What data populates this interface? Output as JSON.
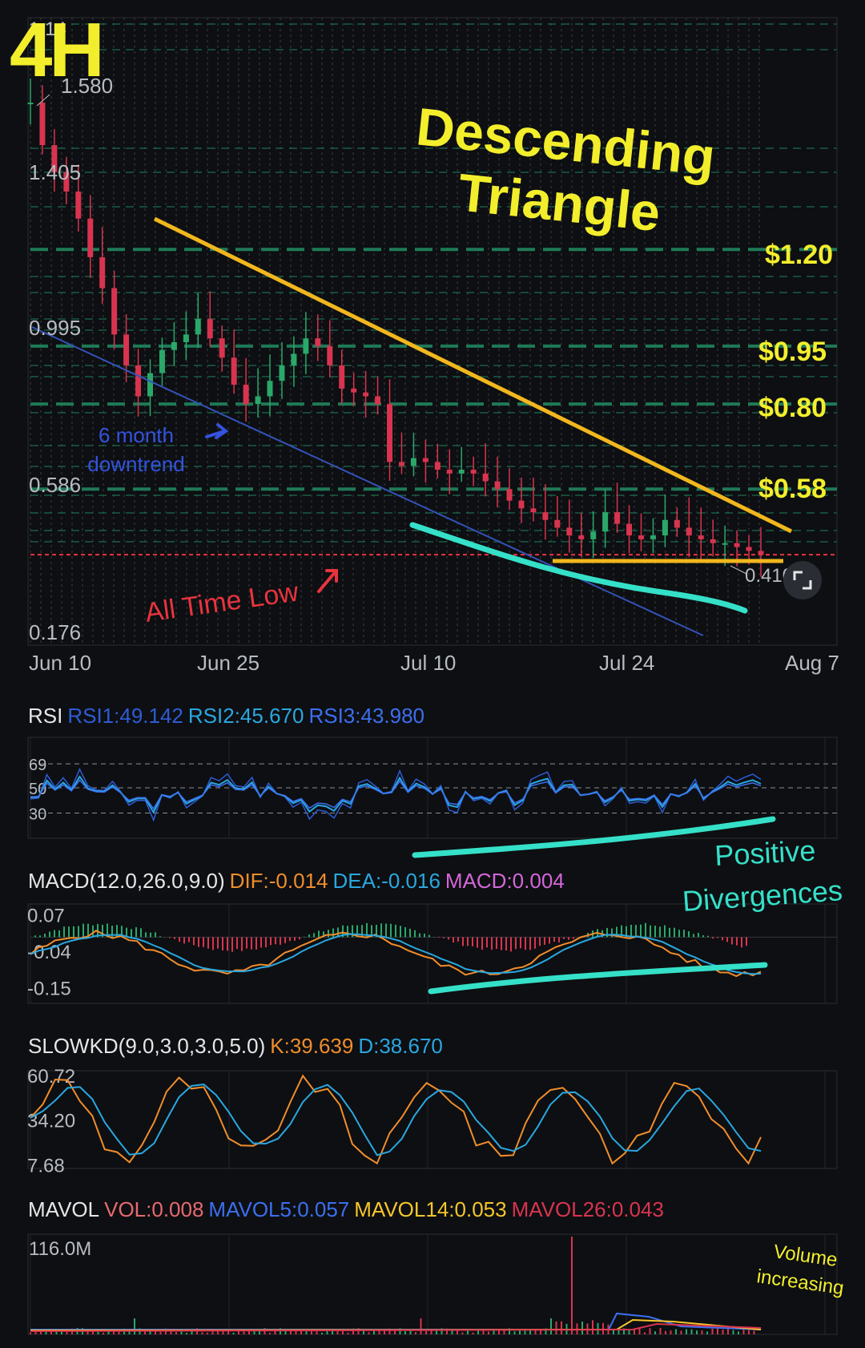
{
  "timeframe": "4H",
  "x_labels": [
    "Jun 10",
    "Jun 25",
    "Jul 10",
    "Jul 24",
    "Aug 7"
  ],
  "price": {
    "axis_labels": [
      "1.580",
      "1.405",
      "0.995",
      "0.586",
      "0.176"
    ],
    "top_partial_label": "1.14",
    "last_price_label": "0.410",
    "level_labels": [
      "$1.20",
      "$0.95",
      "$0.80",
      "$0.58"
    ],
    "ylim": [
      0.176,
      1.8
    ]
  },
  "annotations": {
    "title_line1": "Descending",
    "title_line2": "Triangle",
    "downtrend_line1": "6 month",
    "downtrend_line2": "downtrend",
    "atl": "All Time Low",
    "divergence_line1": "Positive",
    "divergence_line2": "Divergences",
    "volume_line1": "Volume",
    "volume_line2": "increasing"
  },
  "rsi": {
    "label": "RSI",
    "rsi1": "RSI1:49.142",
    "rsi2": "RSI2:45.670",
    "rsi3": "RSI3:43.980",
    "levels": [
      "69",
      "50",
      "30"
    ]
  },
  "macd": {
    "label": "MACD(12.0,26.0,9.0)",
    "dif": "DIF:-0.014",
    "dea": "DEA:-0.016",
    "macd": "MACD:0.004",
    "levels": [
      "0.07",
      "-0.04",
      "-0.15"
    ]
  },
  "slowkd": {
    "label": "SLOWKD(9.0,3.0,3.0,5.0)",
    "k": "K:39.639",
    "d": "D:38.670",
    "levels": [
      "60.72",
      "34.20",
      "7.68"
    ]
  },
  "mavol": {
    "label": "MAVOL",
    "vol": "VOL:0.008",
    "ma5": "MAVOL5:0.057",
    "ma14": "MAVOL14:0.053",
    "ma26": "MAVOL26:0.043",
    "max_label": "116.0M"
  },
  "colors": {
    "up": "#2aa86a",
    "down": "#d8344f",
    "trend": "#f2b71e",
    "teal": "#35e0c8",
    "yellow": "#f3ee2c",
    "red": "#e8343e",
    "blue": "#2f5bd6",
    "grid": "#1f7a57",
    "orange": "#f08d2c",
    "cyan": "#2aa7e0",
    "pink": "#d566d8",
    "mavol_blue": "#3c6ff0",
    "mavol_yellow": "#f6c52b",
    "mavol_red": "#d8344f"
  },
  "chart_data": [
    {
      "type": "candlestick",
      "title": "4H",
      "x": [
        "Jun 10",
        "Jun 25",
        "Jul 10",
        "Jul 24",
        "Aug 7"
      ],
      "close_points": [
        [
          0,
          1.58
        ],
        [
          1,
          1.47
        ],
        [
          2,
          1.4
        ],
        [
          3,
          1.35
        ],
        [
          4,
          1.28
        ],
        [
          5,
          1.18
        ],
        [
          6,
          1.1
        ],
        [
          7,
          0.98
        ],
        [
          8,
          0.9
        ],
        [
          9,
          0.82
        ],
        [
          10,
          0.88
        ],
        [
          11,
          0.94
        ],
        [
          12,
          0.96
        ],
        [
          13,
          0.98
        ],
        [
          14,
          1.02
        ],
        [
          15,
          0.97
        ],
        [
          16,
          0.92
        ],
        [
          17,
          0.85
        ],
        [
          18,
          0.8
        ],
        [
          19,
          0.82
        ],
        [
          20,
          0.86
        ],
        [
          21,
          0.9
        ],
        [
          22,
          0.93
        ],
        [
          23,
          0.97
        ],
        [
          24,
          0.95
        ],
        [
          25,
          0.9
        ],
        [
          26,
          0.84
        ],
        [
          27,
          0.83
        ],
        [
          28,
          0.82
        ],
        [
          29,
          0.8
        ],
        [
          30,
          0.65
        ],
        [
          31,
          0.64
        ],
        [
          32,
          0.66
        ],
        [
          33,
          0.65
        ],
        [
          34,
          0.63
        ],
        [
          35,
          0.62
        ],
        [
          36,
          0.63
        ],
        [
          37,
          0.62
        ],
        [
          38,
          0.6
        ],
        [
          39,
          0.58
        ],
        [
          40,
          0.55
        ],
        [
          41,
          0.53
        ],
        [
          42,
          0.52
        ],
        [
          43,
          0.5
        ],
        [
          44,
          0.48
        ],
        [
          45,
          0.46
        ],
        [
          46,
          0.45
        ],
        [
          47,
          0.47
        ],
        [
          48,
          0.52
        ],
        [
          49,
          0.49
        ],
        [
          50,
          0.46
        ],
        [
          51,
          0.45
        ],
        [
          52,
          0.46
        ],
        [
          53,
          0.5
        ],
        [
          54,
          0.48
        ],
        [
          55,
          0.46
        ],
        [
          56,
          0.45
        ],
        [
          57,
          0.44
        ],
        [
          58,
          0.44
        ],
        [
          59,
          0.43
        ],
        [
          60,
          0.42
        ],
        [
          61,
          0.41
        ]
      ],
      "levels": [
        1.2,
        0.95,
        0.8,
        0.58
      ],
      "all_time_low": 0.41,
      "ylim": [
        0.176,
        1.8
      ]
    },
    {
      "type": "line",
      "title": "RSI",
      "series": [
        {
          "name": "RSI1",
          "last": 49.142
        },
        {
          "name": "RSI2",
          "last": 45.67
        },
        {
          "name": "RSI3",
          "last": 43.98
        }
      ],
      "levels": [
        69,
        50,
        30
      ]
    },
    {
      "type": "line",
      "title": "MACD(12.0,26.0,9.0)",
      "series": [
        {
          "name": "DIF",
          "last": -0.014
        },
        {
          "name": "DEA",
          "last": -0.016
        },
        {
          "name": "MACD",
          "last": 0.004
        }
      ],
      "ylim": [
        -0.15,
        0.07
      ]
    },
    {
      "type": "line",
      "title": "SLOWKD(9.0,3.0,3.0,5.0)",
      "series": [
        {
          "name": "K",
          "last": 39.639
        },
        {
          "name": "D",
          "last": 38.67
        }
      ],
      "ylim": [
        7.68,
        60.72
      ]
    },
    {
      "type": "bar",
      "title": "MAVOL",
      "series": [
        {
          "name": "VOL",
          "last": 0.008
        },
        {
          "name": "MAVOL5",
          "last": 0.057
        },
        {
          "name": "MAVOL14",
          "last": 0.053
        },
        {
          "name": "MAVOL26",
          "last": 0.043
        }
      ],
      "ymax_label": "116.0M"
    }
  ]
}
